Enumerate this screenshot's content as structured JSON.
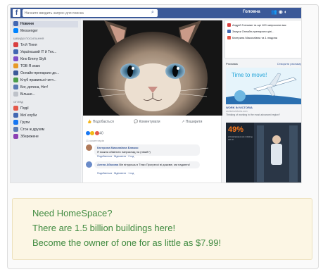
{
  "facebook": {
    "search_placeholder": "Начните вводить запрос для поиска",
    "profile_name": "Головна",
    "sidebar": {
      "items": [
        {
          "label": "Новини",
          "color": "#4267b2",
          "active": true
        },
        {
          "label": "Messenger",
          "color": "#0084ff",
          "active": false
        }
      ],
      "section1_title": "ШВИДКІ ПОСИЛАННЯ",
      "shortcuts": [
        {
          "label": "Ти й Тіння",
          "color": "#d93f3f"
        },
        {
          "label": "Український IT й Тех...",
          "color": "#4267b2"
        },
        {
          "label": "Кіно Emmy Stylt",
          "color": "#7f4fc9"
        },
        {
          "label": "ТОВ Я знаю",
          "color": "#e79a27"
        },
        {
          "label": "Онлайн-препарати до...",
          "color": "#3b5998"
        },
        {
          "label": "Клуб правильні читт...",
          "color": "#4b9e4b"
        },
        {
          "label": "Бог, дитина, Нет!",
          "color": "#5b7bb3"
        },
        {
          "label": "Більше...",
          "color": "#bec2c9"
        }
      ],
      "section2_title": "ОГЛЯД",
      "explore": [
        {
          "label": "Події",
          "color": "#e4584a"
        },
        {
          "label": "Мої клуби",
          "color": "#4267b2"
        },
        {
          "label": "Групи",
          "color": "#1877f2"
        },
        {
          "label": "Стон ж друзям",
          "color": "#5b7bb3"
        },
        {
          "label": "Збережене",
          "color": "#8c3fb3"
        }
      ]
    },
    "post": {
      "actions": [
        "Подобається",
        "Коментувати",
        "Поширити"
      ],
      "reactions_count": "40",
      "comments_label": "11 коментарів",
      "comments": [
        {
          "author": "Катерина Миколаївна Блажко",
          "text": "Я можна обміняти наприклад на (лівий?)",
          "meta": "Подобається · Відповісти · 2 год",
          "avatar_color": "#b07a5a"
        },
        {
          "author": "Алена Абасова",
          "text": "Він вітуришь в Тінки Прогрессі ві доживе, ми падають!",
          "meta": "Подобається · Відповісти · 1 год",
          "avatar_color": "#6a8bc9"
        }
      ]
    },
    "notifications": [
      {
        "text": "Андрій Гончман та ще 100 запросили вас",
        "color": "#d93f3f"
      },
      {
        "text": "Запуск Онлайн-препарати ціні...",
        "color": "#4267b2"
      },
      {
        "text": "Катерина Миколаївна та 1 людина",
        "color": "#e4584a"
      }
    ],
    "ads": {
      "title": "Реклама",
      "create_label": "Створити рекламу",
      "ad1_headline": "Time to move!",
      "ad1_caption": "WORK IN VICTORIA",
      "ad1_url": "worksinvictoria.com",
      "ad1_desc": "Thinking of working in the most advanced region?",
      "ad2_percent": "49%",
      "ad2_text": "of businesses are missing out on"
    }
  },
  "promo": {
    "line1": "Need HomeSpace?",
    "line2": "There are 1.5 billion buildings here!",
    "line3": "Become the owner of one for as little as $7.99!"
  }
}
